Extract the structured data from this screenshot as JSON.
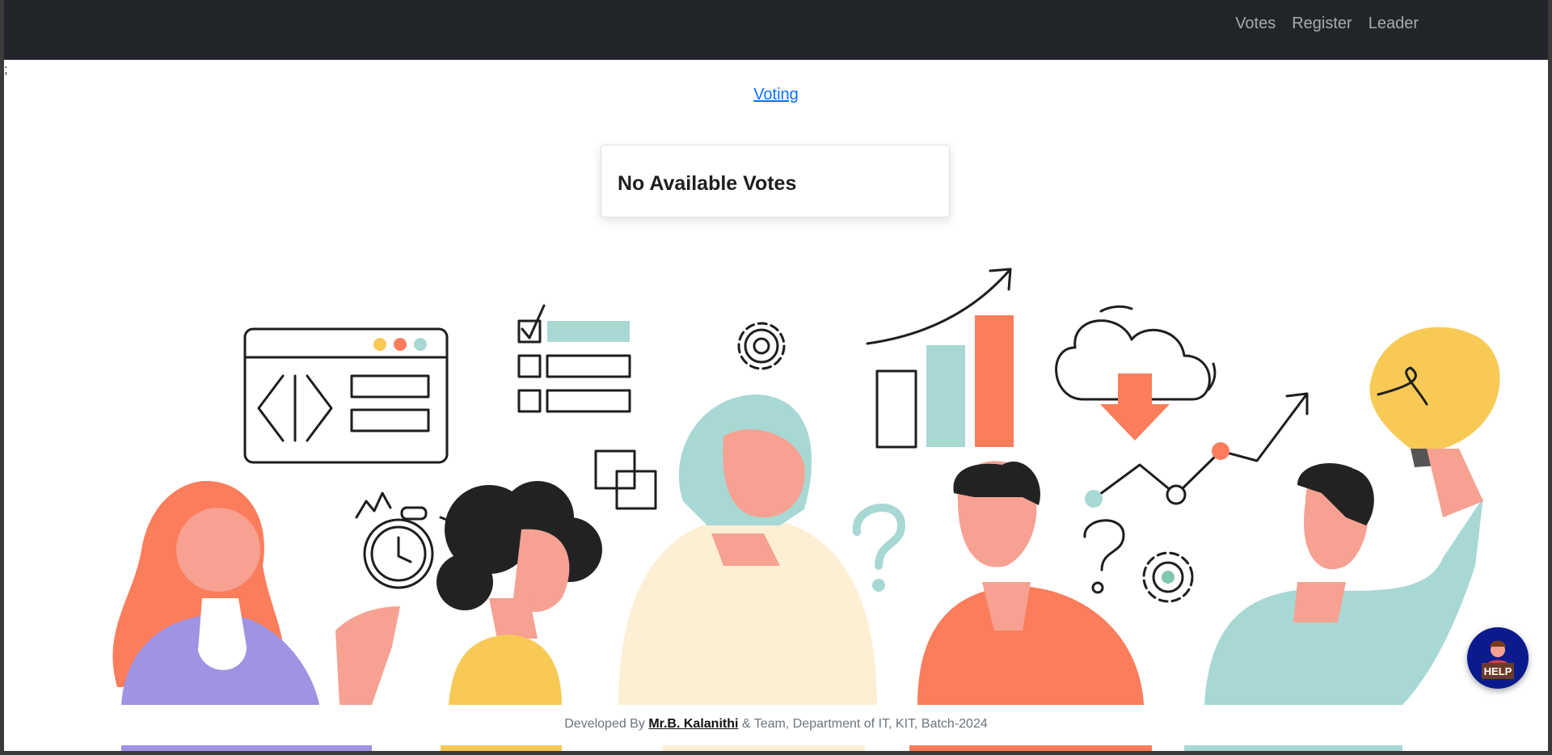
{
  "navbar": {
    "links": [
      "Votes",
      "Register",
      "Leader"
    ]
  },
  "stray_text": ";",
  "voting_link": "Voting",
  "card": {
    "title": "No Available Votes"
  },
  "footer": {
    "prefix": "Developed By",
    "name": "Mr.B. Kalanithi",
    "suffix": "& Team, Department of IT, KIT, Batch-2024"
  },
  "help": {
    "label": "HELP"
  },
  "colors": {
    "navbar": "#212529",
    "nav_link": "#a8abae",
    "link": "#0d6efd",
    "coral": "#fb7d5b",
    "teal": "#a8d8d4",
    "yellow": "#f8c955",
    "purple": "#9f93e4",
    "cream": "#fdefd4",
    "skin": "#f6a192",
    "help_bg": "#0b1a8c"
  },
  "icons": [
    "code-window-icon",
    "checklist-icon",
    "gear-icon",
    "bar-chart-icon",
    "cloud-download-icon",
    "lightbulb-icon",
    "stopwatch-icon",
    "question-icon",
    "help-icon"
  ]
}
